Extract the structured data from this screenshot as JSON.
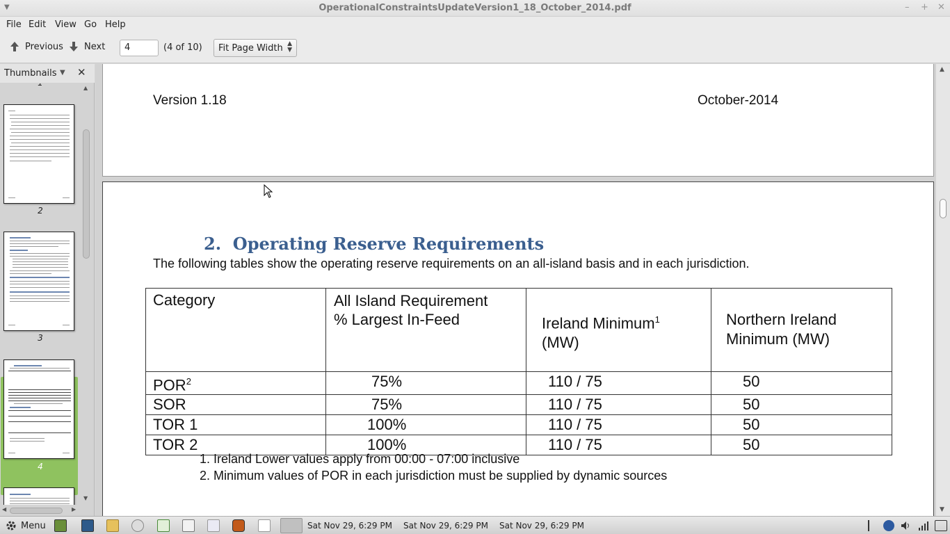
{
  "window": {
    "title": "OperationalConstraintsUpdateVersion1_18_October_2014.pdf"
  },
  "menubar": {
    "items": [
      "File",
      "Edit",
      "View",
      "Go",
      "Help"
    ]
  },
  "toolbar": {
    "previous_label": "Previous",
    "next_label": "Next",
    "page_value": "4",
    "page_count": "(4 of 10)",
    "zoom_value": "Fit Page Width"
  },
  "sidebar": {
    "title": "Thumbnails",
    "top_partial_number": "1",
    "thumbnails": [
      {
        "number": "2"
      },
      {
        "number": "3"
      },
      {
        "number": "4",
        "selected": true
      }
    ]
  },
  "page3": {
    "header_left": "Version 1.18",
    "header_right": "October-2014"
  },
  "page4": {
    "heading_number": "2.",
    "heading": "Operating Reserve Requirements",
    "intro": "The following tables show the operating reserve requirements on an all-island basis and in each jurisdiction.",
    "table": {
      "headers": {
        "c1": "Category",
        "c2_line1": "All Island Requirement",
        "c2_line2": "% Largest In-Feed",
        "c3_line1": "Ireland Minimum",
        "c3_sup": "1",
        "c3_line2": "(MW)",
        "c4_line1": "Northern Ireland",
        "c4_line2": "Minimum (MW)"
      },
      "rows": [
        {
          "category": "POR",
          "sup": "2",
          "all_island": "75%",
          "ireland": "110 / 75",
          "ni": "50"
        },
        {
          "category": "SOR",
          "sup": "",
          "all_island": "75%",
          "ireland": "110 / 75",
          "ni": "50"
        },
        {
          "category": "TOR 1",
          "sup": "",
          "all_island": "100%",
          "ireland": "110 / 75",
          "ni": "50"
        },
        {
          "category": "TOR 2",
          "sup": "",
          "all_island": "100%",
          "ireland": "110 / 75",
          "ni": "50"
        }
      ]
    },
    "notes": [
      "1. Ireland Lower values apply from 00:00 - 07:00 inclusive",
      "2. Minimum values of POR in each jurisdiction must be supplied by dynamic sources"
    ]
  },
  "taskbar": {
    "menu_label": "Menu",
    "clocks": [
      "Sat Nov 29,  6:29 PM",
      "Sat Nov 29,  6:29 PM",
      "Sat Nov 29,  6:29 PM"
    ]
  },
  "colors": {
    "heading": "#3b5f8f",
    "selection": "#8fc25f"
  }
}
